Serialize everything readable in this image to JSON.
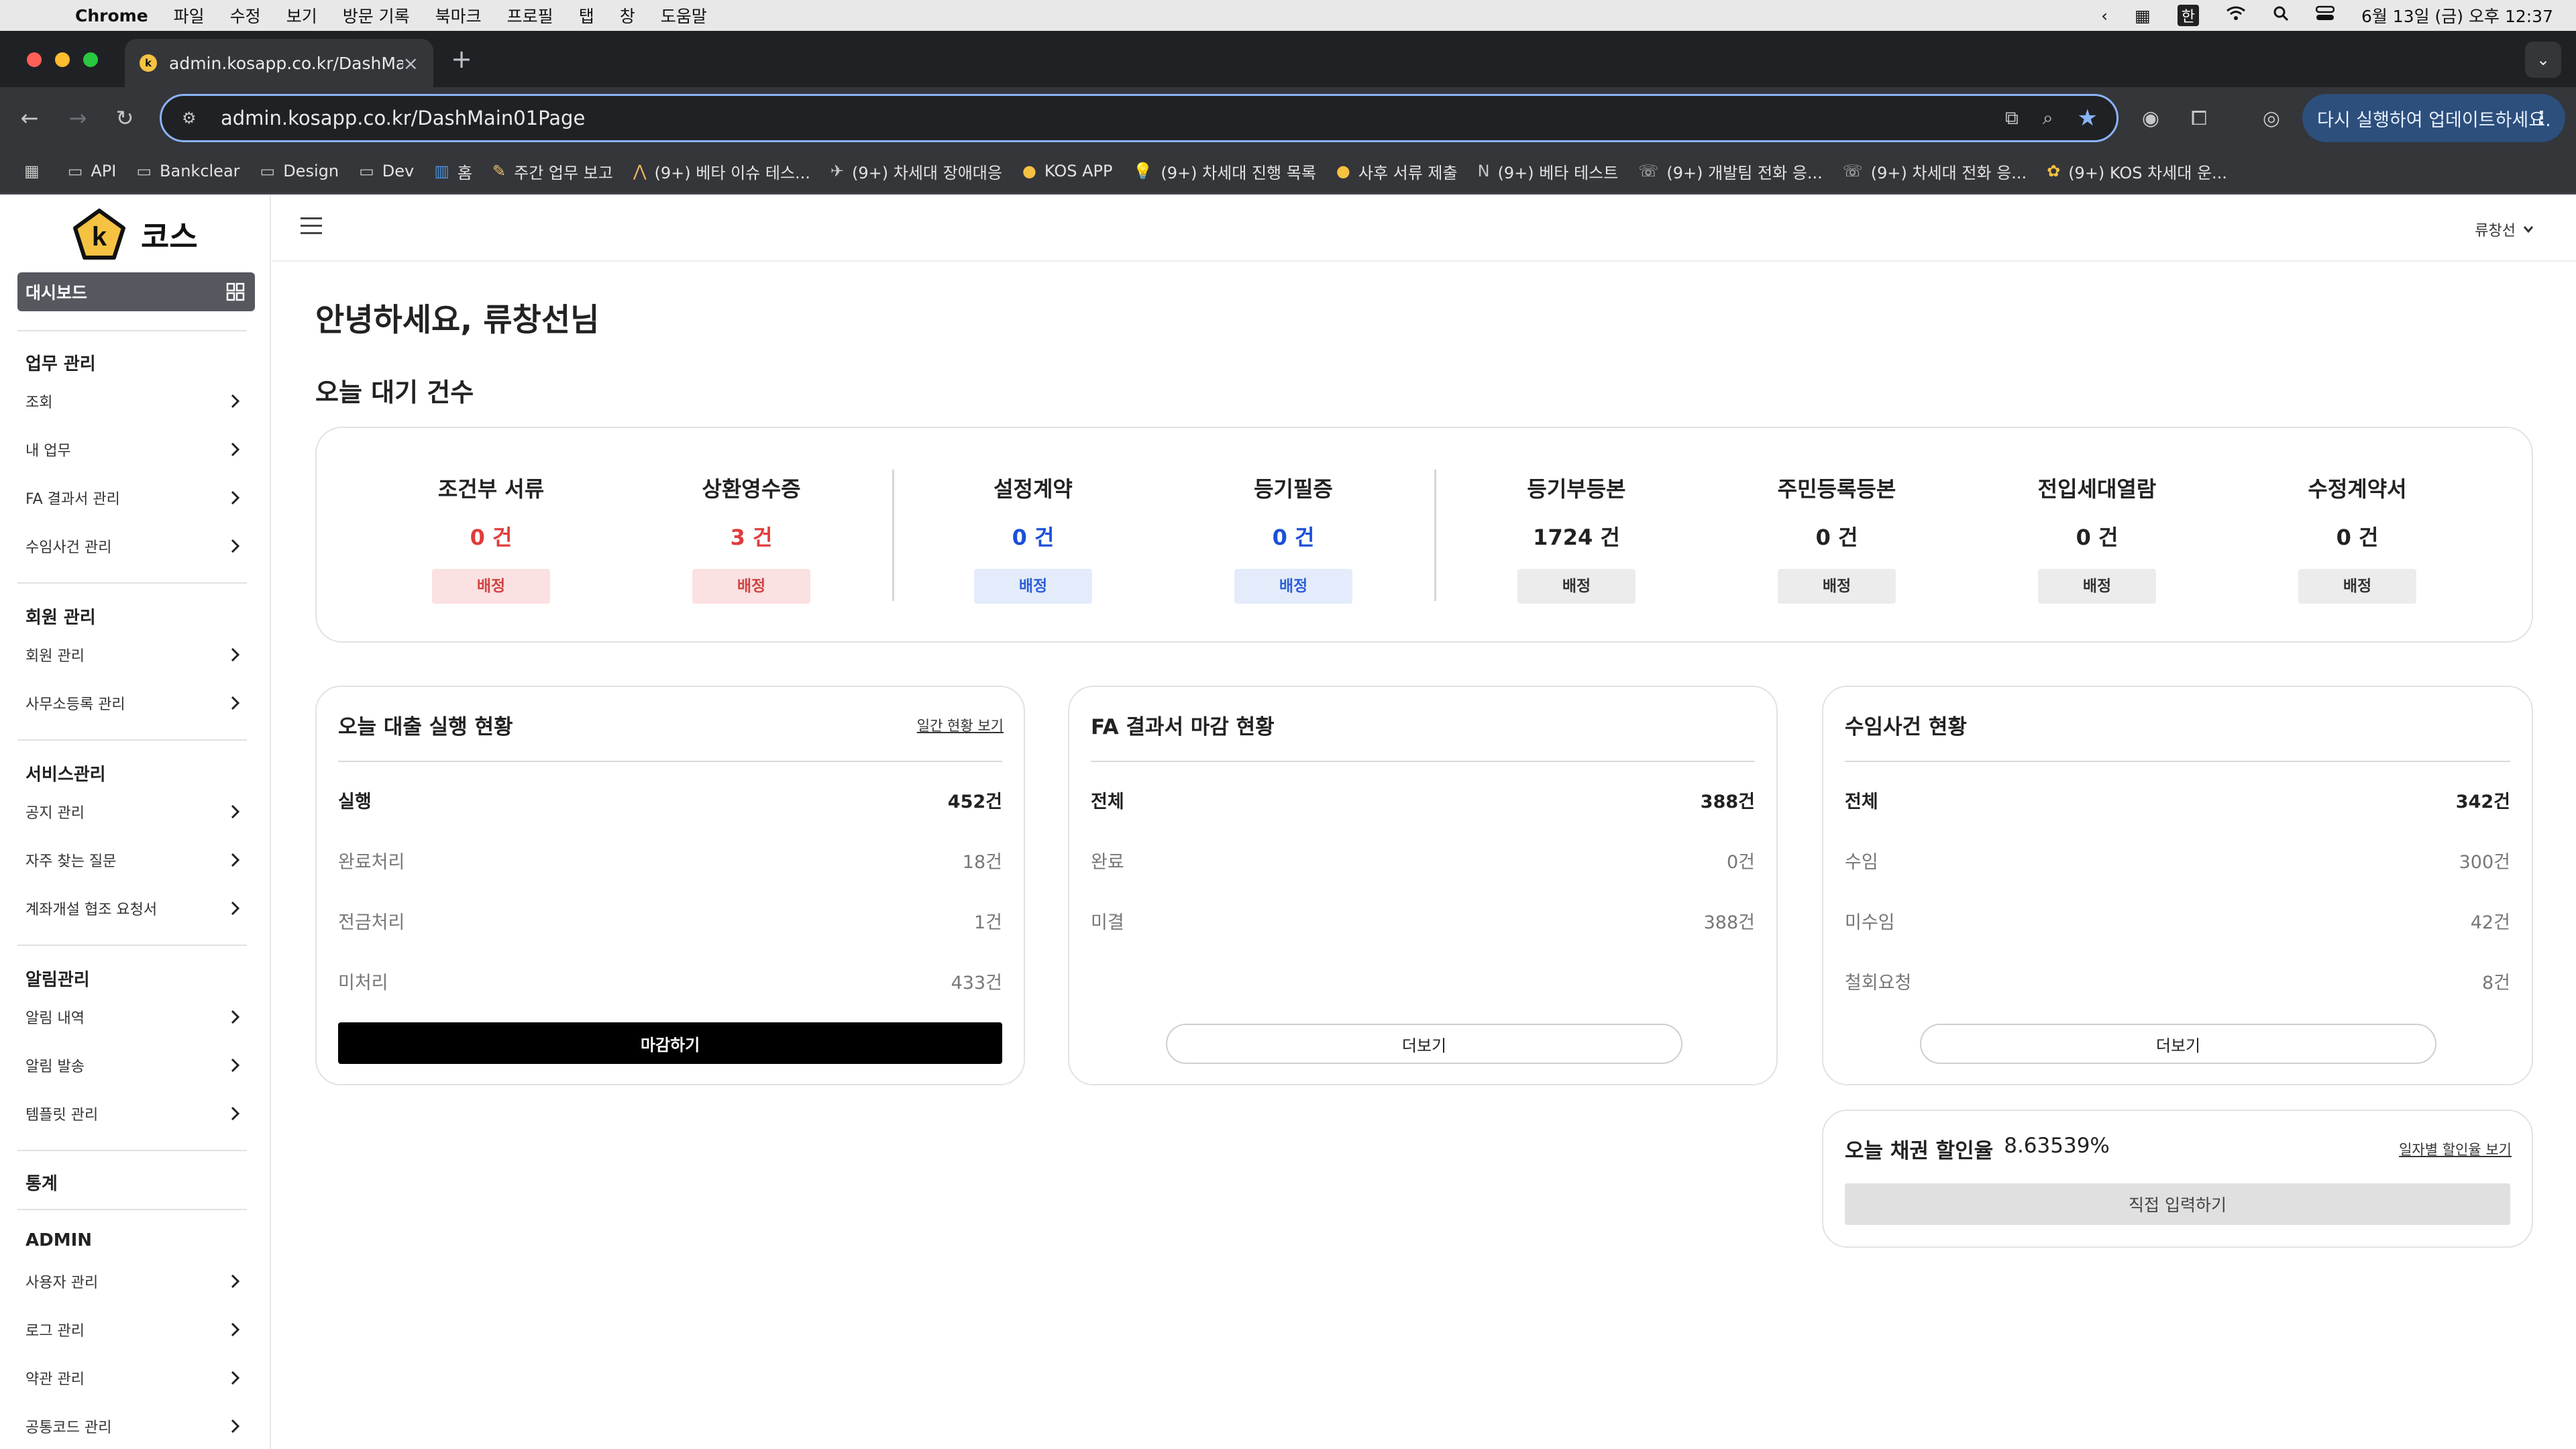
{
  "macos_menubar": {
    "app": "Chrome",
    "menus": [
      "파일",
      "수정",
      "보기",
      "방문 기록",
      "북마크",
      "프로필",
      "탭",
      "창",
      "도움말"
    ],
    "input_source": "한",
    "datetime": "6월 13일 (금) 오후 12:37"
  },
  "browser": {
    "tab_title": "admin.kosapp.co.kr/DashMain",
    "url": "admin.kosapp.co.kr/DashMain01Page",
    "update_button": "다시 실행하여 업데이트하세요.",
    "bookmarks": [
      {
        "label": "API",
        "icon": "folder-icon"
      },
      {
        "label": "Bankclear",
        "icon": "folder-icon"
      },
      {
        "label": "Design",
        "icon": "folder-icon"
      },
      {
        "label": "Dev",
        "icon": "folder-icon"
      },
      {
        "label": "홈",
        "icon": "trello-icon"
      },
      {
        "label": "주간 업무 보고",
        "icon": "note-icon"
      },
      {
        "label": "(9+) 베타 이슈 테스...",
        "icon": "pray-icon"
      },
      {
        "label": "(9+) 차세대 장애대응",
        "icon": "plane-icon"
      },
      {
        "label": "KOS APP",
        "icon": "kos-icon"
      },
      {
        "label": "(9+) 차세대 진행 목록",
        "icon": "bulb-icon"
      },
      {
        "label": "사후 서류 제출",
        "icon": "kos-icon"
      },
      {
        "label": "(9+) 베타 테스트",
        "icon": "notion-icon"
      },
      {
        "label": "(9+) 개발팀 전화 응...",
        "icon": "phone-icon"
      },
      {
        "label": "(9+) 차세대 전화 응...",
        "icon": "phone-icon"
      },
      {
        "label": "(9+) KOS 차세대 운...",
        "icon": "flower-icon"
      }
    ]
  },
  "sidebar": {
    "brand": "코스",
    "active_item": "대시보드",
    "sections": [
      {
        "title": "업무 관리",
        "items": [
          "조회",
          "내 업무",
          "FA 결과서 관리",
          "수임사건 관리"
        ]
      },
      {
        "title": "회원 관리",
        "items": [
          "회원 관리",
          "사무소등록 관리"
        ]
      },
      {
        "title": "서비스관리",
        "items": [
          "공지 관리",
          "자주 찾는 질문",
          "계좌개설 협조 요청서"
        ]
      },
      {
        "title": "알림관리",
        "items": [
          "알림 내역",
          "알림 발송",
          "템플릿 관리"
        ]
      },
      {
        "title": "통계",
        "items": []
      },
      {
        "title": "ADMIN",
        "items": [
          "사용자 관리",
          "로그 관리",
          "약관 관리",
          "공통코드 관리"
        ]
      }
    ]
  },
  "header": {
    "user": "류창선"
  },
  "greeting": "안녕하세요, 류창선님",
  "waiting": {
    "title": "오늘 대기 건수",
    "items": [
      {
        "label": "조건부 서류",
        "count": "0 건",
        "button": "배정",
        "tone": "red"
      },
      {
        "label": "상환영수증",
        "count": "3 건",
        "button": "배정",
        "tone": "red"
      },
      {
        "label": "설정계약",
        "count": "0 건",
        "button": "배정",
        "tone": "blue"
      },
      {
        "label": "등기필증",
        "count": "0 건",
        "button": "배정",
        "tone": "blue"
      },
      {
        "label": "등기부등본",
        "count": "1724 건",
        "button": "배정",
        "tone": "gray"
      },
      {
        "label": "주민등록등본",
        "count": "0 건",
        "button": "배정",
        "tone": "gray"
      },
      {
        "label": "전입세대열람",
        "count": "0 건",
        "button": "배정",
        "tone": "gray"
      },
      {
        "label": "수정계약서",
        "count": "0 건",
        "button": "배정",
        "tone": "gray"
      }
    ]
  },
  "loan_card": {
    "title": "오늘 대출 실행 현황",
    "link": "일간 현황 보기",
    "rows": [
      {
        "label": "실행",
        "value": "452건"
      },
      {
        "label": "완료처리",
        "value": "18건"
      },
      {
        "label": "전금처리",
        "value": "1건"
      },
      {
        "label": "미처리",
        "value": "433건"
      }
    ],
    "button": "마감하기"
  },
  "fa_card": {
    "title": "FA 결과서 마감 현황",
    "rows": [
      {
        "label": "전체",
        "value": "388건"
      },
      {
        "label": "완료",
        "value": "0건"
      },
      {
        "label": "미결",
        "value": "388건"
      }
    ],
    "button": "더보기"
  },
  "case_card": {
    "title": "수임사건 현황",
    "rows": [
      {
        "label": "전체",
        "value": "342건"
      },
      {
        "label": "수임",
        "value": "300건"
      },
      {
        "label": "미수임",
        "value": "42건"
      },
      {
        "label": "철회요청",
        "value": "8건"
      }
    ],
    "button": "더보기"
  },
  "bond_card": {
    "title": "오늘 채권 할인율",
    "value": "8.63539%",
    "link": "일자별 할인율 보기",
    "button": "직접 입력하기"
  },
  "colors": {
    "red": "#e03c3c",
    "blue": "#1c50d8",
    "accent_update": "#2c4f7c"
  }
}
